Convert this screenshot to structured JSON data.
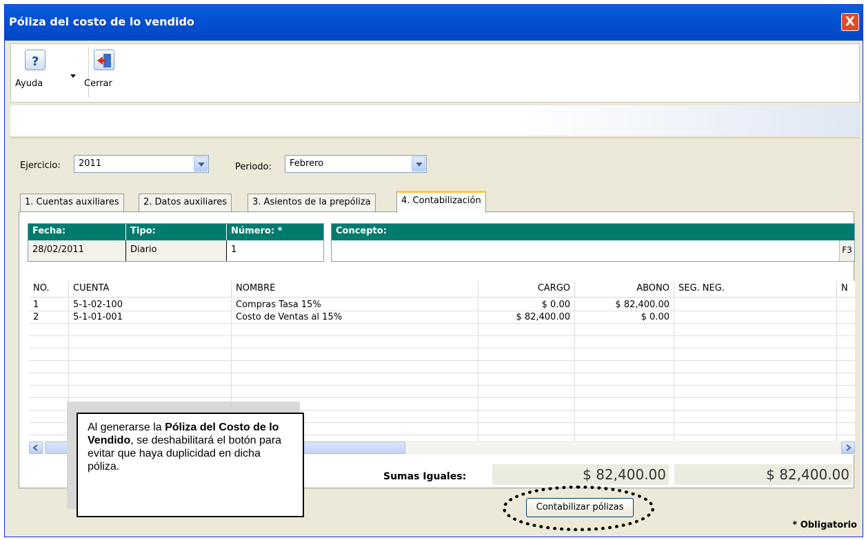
{
  "window": {
    "title": "Póliza del costo de lo vendido",
    "close_label": "X"
  },
  "toolbar": {
    "help_label": "Ayuda",
    "close_label": "Cerrar"
  },
  "filters": {
    "ejercicio_label": "Ejercicio:",
    "ejercicio_value": "2011",
    "periodo_label": "Periodo:",
    "periodo_value": "Febrero"
  },
  "tabs": [
    {
      "label": "1. Cuentas auxiliares"
    },
    {
      "label": "2. Datos auxiliares"
    },
    {
      "label": "3. Asientos de la prepóliza"
    },
    {
      "label": "4. Contabilización"
    }
  ],
  "header": {
    "fecha_label": "Fecha:",
    "fecha_value": "28/02/2011",
    "tipo_label": "Tipo:",
    "tipo_value": "Diario",
    "numero_label": "Número: *",
    "numero_value": "1",
    "concepto_label": "Concepto:",
    "concepto_value": "",
    "f3_label": "F3"
  },
  "grid": {
    "columns": [
      "NO.",
      "CUENTA",
      "NOMBRE",
      "CARGO",
      "ABONO",
      "SEG. NEG.",
      "N"
    ],
    "rows": [
      {
        "no": "1",
        "cuenta": "5-1-02-100",
        "nombre": "Compras Tasa 15%",
        "cargo": "$ 0.00",
        "abono": "$ 82,400.00"
      },
      {
        "no": "2",
        "cuenta": "5-1-01-001",
        "nombre": "Costo de Ventas al 15%",
        "cargo": "$ 82,400.00",
        "abono": "$ 0.00"
      }
    ]
  },
  "totals": {
    "label": "Sumas Iguales:",
    "cargo": "$ 82,400.00",
    "abono": "$ 82,400.00"
  },
  "actions": {
    "contabilizar_label": "Contabilizar pólizas"
  },
  "callout": {
    "t1": "Al generarse la ",
    "t2": "Póliza del Costo de lo Vendido",
    "t3": ", se deshabilitará  el botón para evitar que haya duplicidad en dicha póliza."
  },
  "footer": {
    "required_note": "* Obligatorio"
  }
}
